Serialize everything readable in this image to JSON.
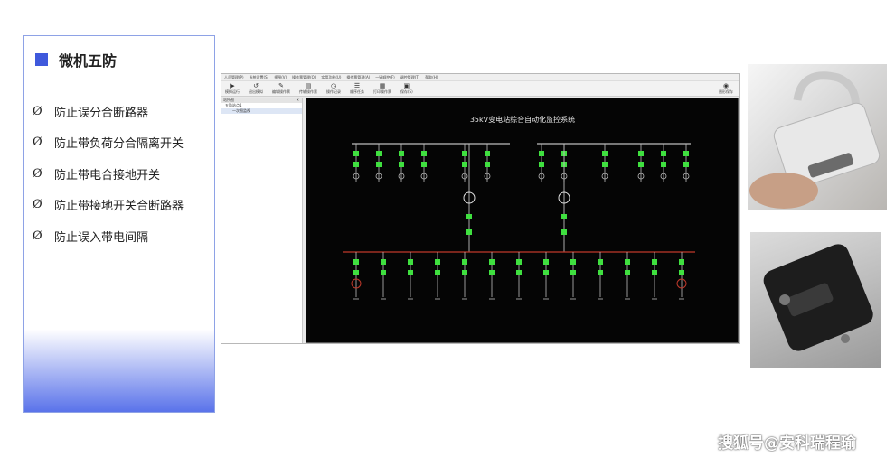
{
  "panel": {
    "title": "微机五防",
    "bullet_symbol": "Ø",
    "rules": [
      "防止误分合断路器",
      "防止带负荷分合隔离开关",
      "防止带电合接地开关",
      "防止带接地开关合断路器",
      "防止误入带电间隔"
    ]
  },
  "app": {
    "menu": [
      "人员管理(P)",
      "系统设置(S)",
      "视图(V)",
      "操作票管理(O)",
      "实用功能(U)",
      "操作票管理(A)",
      "一键顺控(F)",
      "调控管理(T)",
      "帮助(H)"
    ],
    "toolbar": [
      {
        "icon": "play-icon",
        "label": "模拟运行"
      },
      {
        "icon": "undo-icon",
        "label": "退出模拟"
      },
      {
        "icon": "edit-icon",
        "label": "编辑操作票"
      },
      {
        "icon": "print-icon",
        "label": "传输操作票"
      },
      {
        "icon": "clock-icon",
        "label": "操作记录"
      },
      {
        "icon": "list-icon",
        "label": "顺序任务"
      },
      {
        "icon": "doc-icon",
        "label": "打印操作票"
      },
      {
        "icon": "save-icon",
        "label": "保存(S)"
      }
    ],
    "toolbar_right": {
      "icon": "camera-icon",
      "label": "图形保存"
    },
    "sidebar": {
      "header": "站所图",
      "items": [
        "五防站点1",
        "一次图监视"
      ]
    },
    "diagram_title": "35kV变电站综合自动化监控系统"
  },
  "watermark": "搜狐号@安科瑞程瑜",
  "colors": {
    "accent": "#3f59dc",
    "scada_bg": "#050505",
    "switch_green": "#3fe03f",
    "bus_red": "#c0392b",
    "wire_gray": "#bdbdbd"
  }
}
